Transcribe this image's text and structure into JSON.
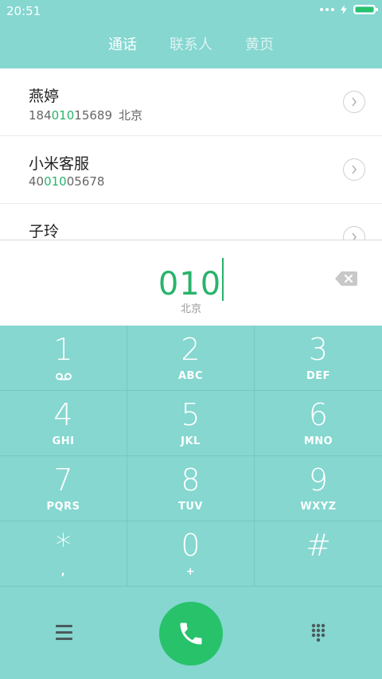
{
  "status": {
    "time": "20:51"
  },
  "tabs": [
    {
      "label": "通话",
      "active": true
    },
    {
      "label": "联系人",
      "active": false
    },
    {
      "label": "黄页",
      "active": false
    }
  ],
  "results": [
    {
      "name": "燕婷",
      "pre": "184",
      "hl": "010",
      "post": "15689",
      "location": "北京"
    },
    {
      "name": "小米客服",
      "pre": "40",
      "hl": "010",
      "post": "05678",
      "location": ""
    },
    {
      "name": "子玲",
      "pre": "",
      "hl": "",
      "post": "",
      "location": ""
    }
  ],
  "entry": {
    "digits": "010",
    "location": "北京"
  },
  "keypad": [
    {
      "digit": "1",
      "letters": ""
    },
    {
      "digit": "2",
      "letters": "ABC"
    },
    {
      "digit": "3",
      "letters": "DEF"
    },
    {
      "digit": "4",
      "letters": "GHI"
    },
    {
      "digit": "5",
      "letters": "JKL"
    },
    {
      "digit": "6",
      "letters": "MNO"
    },
    {
      "digit": "7",
      "letters": "PQRS"
    },
    {
      "digit": "8",
      "letters": "TUV"
    },
    {
      "digit": "9",
      "letters": "WXYZ"
    },
    {
      "digit": "*",
      "letters": ","
    },
    {
      "digit": "0",
      "letters": "+"
    },
    {
      "digit": "#",
      "letters": ""
    }
  ],
  "colors": {
    "accent": "#27c26a",
    "digits": "#27b46a",
    "background": "#85d7d0"
  },
  "icons": {
    "voicemail": "voicemail-icon",
    "delete": "backspace-icon",
    "call": "phone-icon",
    "menu": "menu-icon",
    "dialpad": "dialpad-icon"
  }
}
